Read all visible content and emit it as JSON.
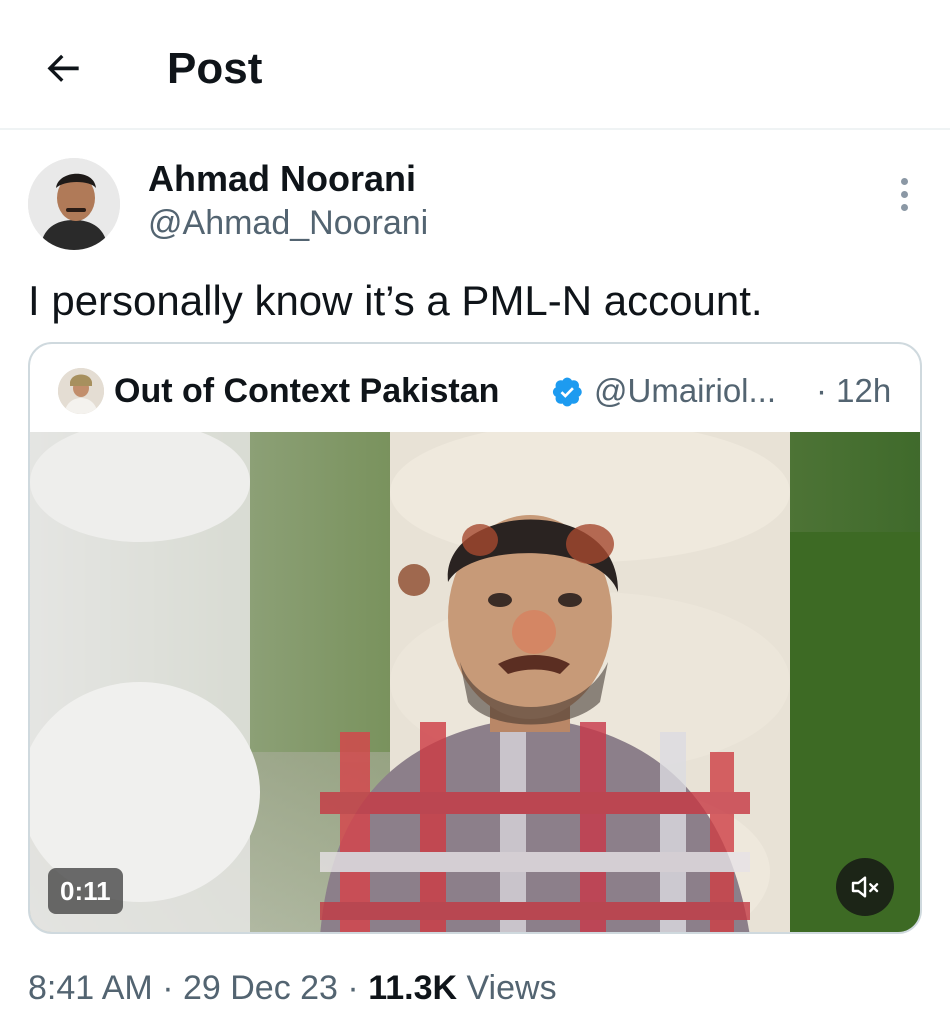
{
  "header": {
    "title": "Post",
    "back_icon": "arrow-left-icon"
  },
  "tweet": {
    "author_name": "Ahmad Noorani",
    "author_handle": "@Ahmad_Noorani",
    "text": "I personally know it’s a PML-N account.",
    "more_icon": "more-vertical-icon"
  },
  "quote": {
    "author_name": "Out of Context Pakistan",
    "verified_icon": "verified-badge-icon",
    "author_handle": "@Umairiol...",
    "time": "· 12h",
    "video": {
      "duration": "0:11",
      "mute_icon": "speaker-muted-icon"
    }
  },
  "meta": {
    "time": "8:41 AM",
    "sep1": " · ",
    "date": "29 Dec 23",
    "sep2": " · ",
    "views_count": "11.3K",
    "views_label": " Views"
  },
  "colors": {
    "text_primary": "#0f1419",
    "text_secondary": "#536471",
    "border": "#cfd9de",
    "verified": "#1d9bf0"
  }
}
